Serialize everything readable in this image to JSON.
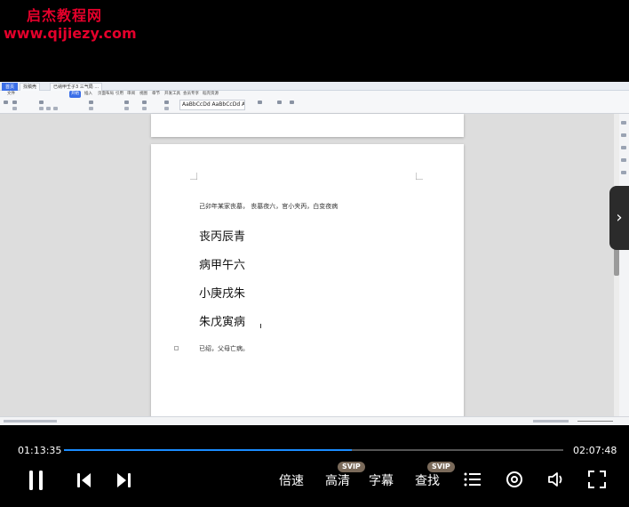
{
  "watermark": {
    "title": "启杰教程网",
    "url": "www.qijiezy.com"
  },
  "screen": {
    "tabs": [
      "首页",
      "找稿壳",
      "已纳甲壬子3 三气局 ..."
    ],
    "menu": [
      "文件",
      "开始",
      "插入",
      "页面布局",
      "引用",
      "审阅",
      "视图",
      "章节",
      "开发工具",
      "会员专享",
      "稻壳资源"
    ],
    "menu_active": "开始",
    "style_sample": "AaBbCcDd AaBbCcDd AaBbC AaBbC",
    "doc_lines_small_top": "己卯年某家丧墓，  丧墓夜六，官小夹丙，白变夜病",
    "doc_lines_big": [
      "丧丙辰青",
      "病甲午六",
      "小庚戌朱",
      "朱戊寅病"
    ],
    "doc_line_small_bottom": "已绍，父母亡病。"
  },
  "player": {
    "elapsed": "01:13:35",
    "total": "02:07:48",
    "progress": 0.576,
    "speed_label": "倍速",
    "hd_label": "高清",
    "subtitle_label": "字幕",
    "search_label": "查找",
    "svip_badge": "SVIP",
    "side_arrow": "›"
  },
  "colors": {
    "accent": "#1a8cff",
    "watermark": "#e4002b"
  }
}
